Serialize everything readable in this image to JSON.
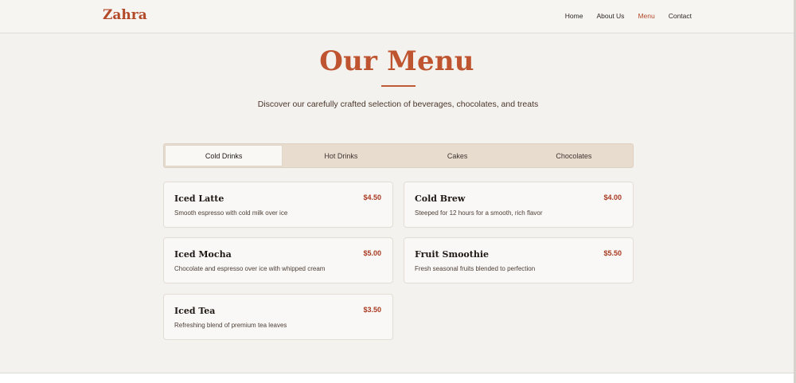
{
  "brand": "Zahra",
  "nav": [
    "Home",
    "About Us",
    "Menu",
    "Contact"
  ],
  "hero": {
    "title": "Our Menu",
    "subtitle": "Discover our carefully crafted selection of beverages, chocolates, and treats"
  },
  "tabs": [
    "Cold Drinks",
    "Hot Drinks",
    "Cakes",
    "Chocolates"
  ],
  "active_tab": "Cold Drinks",
  "items": [
    {
      "name": "Iced Latte",
      "desc": "Smooth espresso with cold milk over ice",
      "price": "$4.50"
    },
    {
      "name": "Cold Brew",
      "desc": "Steeped for 12 hours for a smooth, rich flavor",
      "price": "$4.00"
    },
    {
      "name": "Iced Mocha",
      "desc": "Chocolate and espresso over ice with whipped cream",
      "price": "$5.00"
    },
    {
      "name": "Fruit Smoothie",
      "desc": "Fresh seasonal fruits blended to perfection",
      "price": "$5.50"
    },
    {
      "name": "Iced Tea",
      "desc": "Refreshing blend of premium tea leaves",
      "price": "$3.50"
    }
  ],
  "colors": {
    "accent": "#bf5430",
    "price": "#a83a22",
    "background": "#f4f2ee"
  }
}
